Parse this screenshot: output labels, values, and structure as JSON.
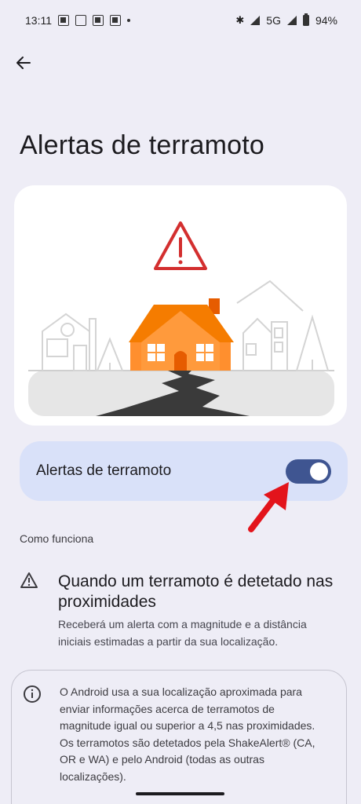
{
  "status_bar": {
    "time": "13:11",
    "network": "5G",
    "battery": "94%"
  },
  "page": {
    "title": "Alertas de terramoto"
  },
  "toggle": {
    "label": "Alertas de terramoto",
    "state": "on"
  },
  "section": {
    "label": "Como funciona"
  },
  "info": {
    "title": "Quando um terramoto é detetado nas proximidades",
    "description": "Receberá um alerta com a magnitude e a distância iniciais estimadas a partir da sua localização."
  },
  "notice": {
    "text": "O Android usa a sua localização aproximada para enviar informações acerca de terramotos de magnitude igual ou superior a 4,5 nas proximidades. Os terramotos são detetados pela ShakeAlert® (CA, OR e WA) e pelo Android (todas as outras localizações)."
  },
  "colors": {
    "background": "#eeedf6",
    "toggle_card": "#d9e1f9",
    "switch_track": "#3f5591",
    "house": "#f57c00",
    "warning_red": "#d32f2f",
    "annotation_arrow": "#e3141b"
  },
  "icons": {
    "back": "arrow-left-icon",
    "info_row": "warning-triangle-icon",
    "notice": "info-circle-icon",
    "illustration": "earthquake-house-illustration"
  }
}
